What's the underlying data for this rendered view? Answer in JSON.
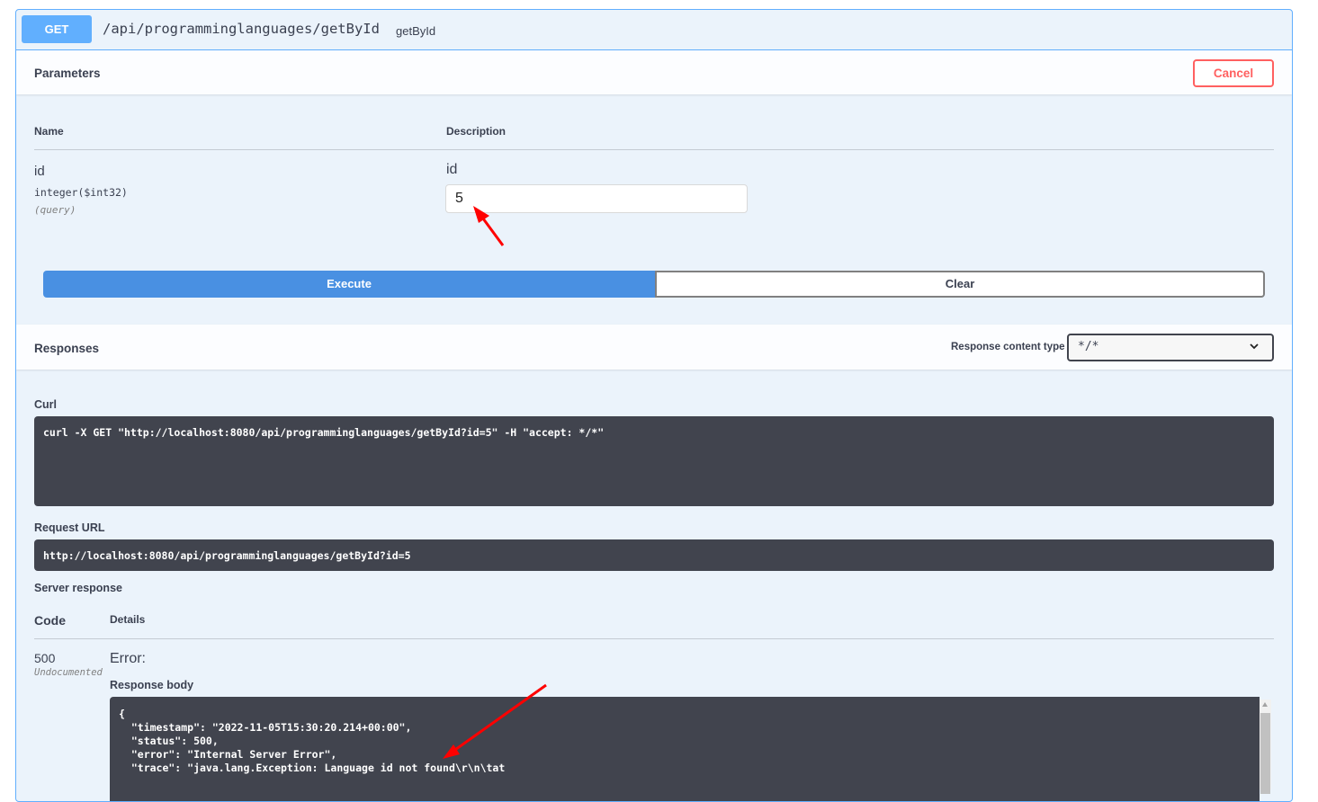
{
  "operation": {
    "method": "GET",
    "path": "/api/programminglanguages/getById",
    "operation_id": "getById"
  },
  "parameters": {
    "title": "Parameters",
    "cancel_label": "Cancel",
    "col_name": "Name",
    "col_description": "Description",
    "items": [
      {
        "name": "id",
        "type": "integer($int32)",
        "in": "(query)",
        "description": "id",
        "value": "5"
      }
    ]
  },
  "actions": {
    "execute_label": "Execute",
    "clear_label": "Clear"
  },
  "responses": {
    "title": "Responses",
    "content_type_label": "Response content type",
    "content_type_value": "*/*",
    "curl_label": "Curl",
    "curl_command": "curl -X GET \"http://localhost:8080/api/programminglanguages/getById?id=5\" -H \"accept: */*\"",
    "request_url_label": "Request URL",
    "request_url": "http://localhost:8080/api/programminglanguages/getById?id=5",
    "server_response_label": "Server response",
    "col_code": "Code",
    "col_details": "Details",
    "code": "500",
    "code_note": "Undocumented",
    "error_title": "Error:",
    "response_body_label": "Response body",
    "response_body_lines": [
      "{",
      "  \"timestamp\": \"2022-11-05T15:30:20.214+00:00\",",
      "  \"status\": 500,",
      "  \"error\": \"Internal Server Error\",",
      "  \"trace\": \"java.lang.Exception: Language id not found\\r\\n\\tat"
    ]
  },
  "annotations": {
    "arrow_color": "#ff0000"
  },
  "colors": {
    "get_method": "#61affe",
    "execute": "#4990e2",
    "cancel": "#ff6060",
    "code_background": "#41444e"
  }
}
